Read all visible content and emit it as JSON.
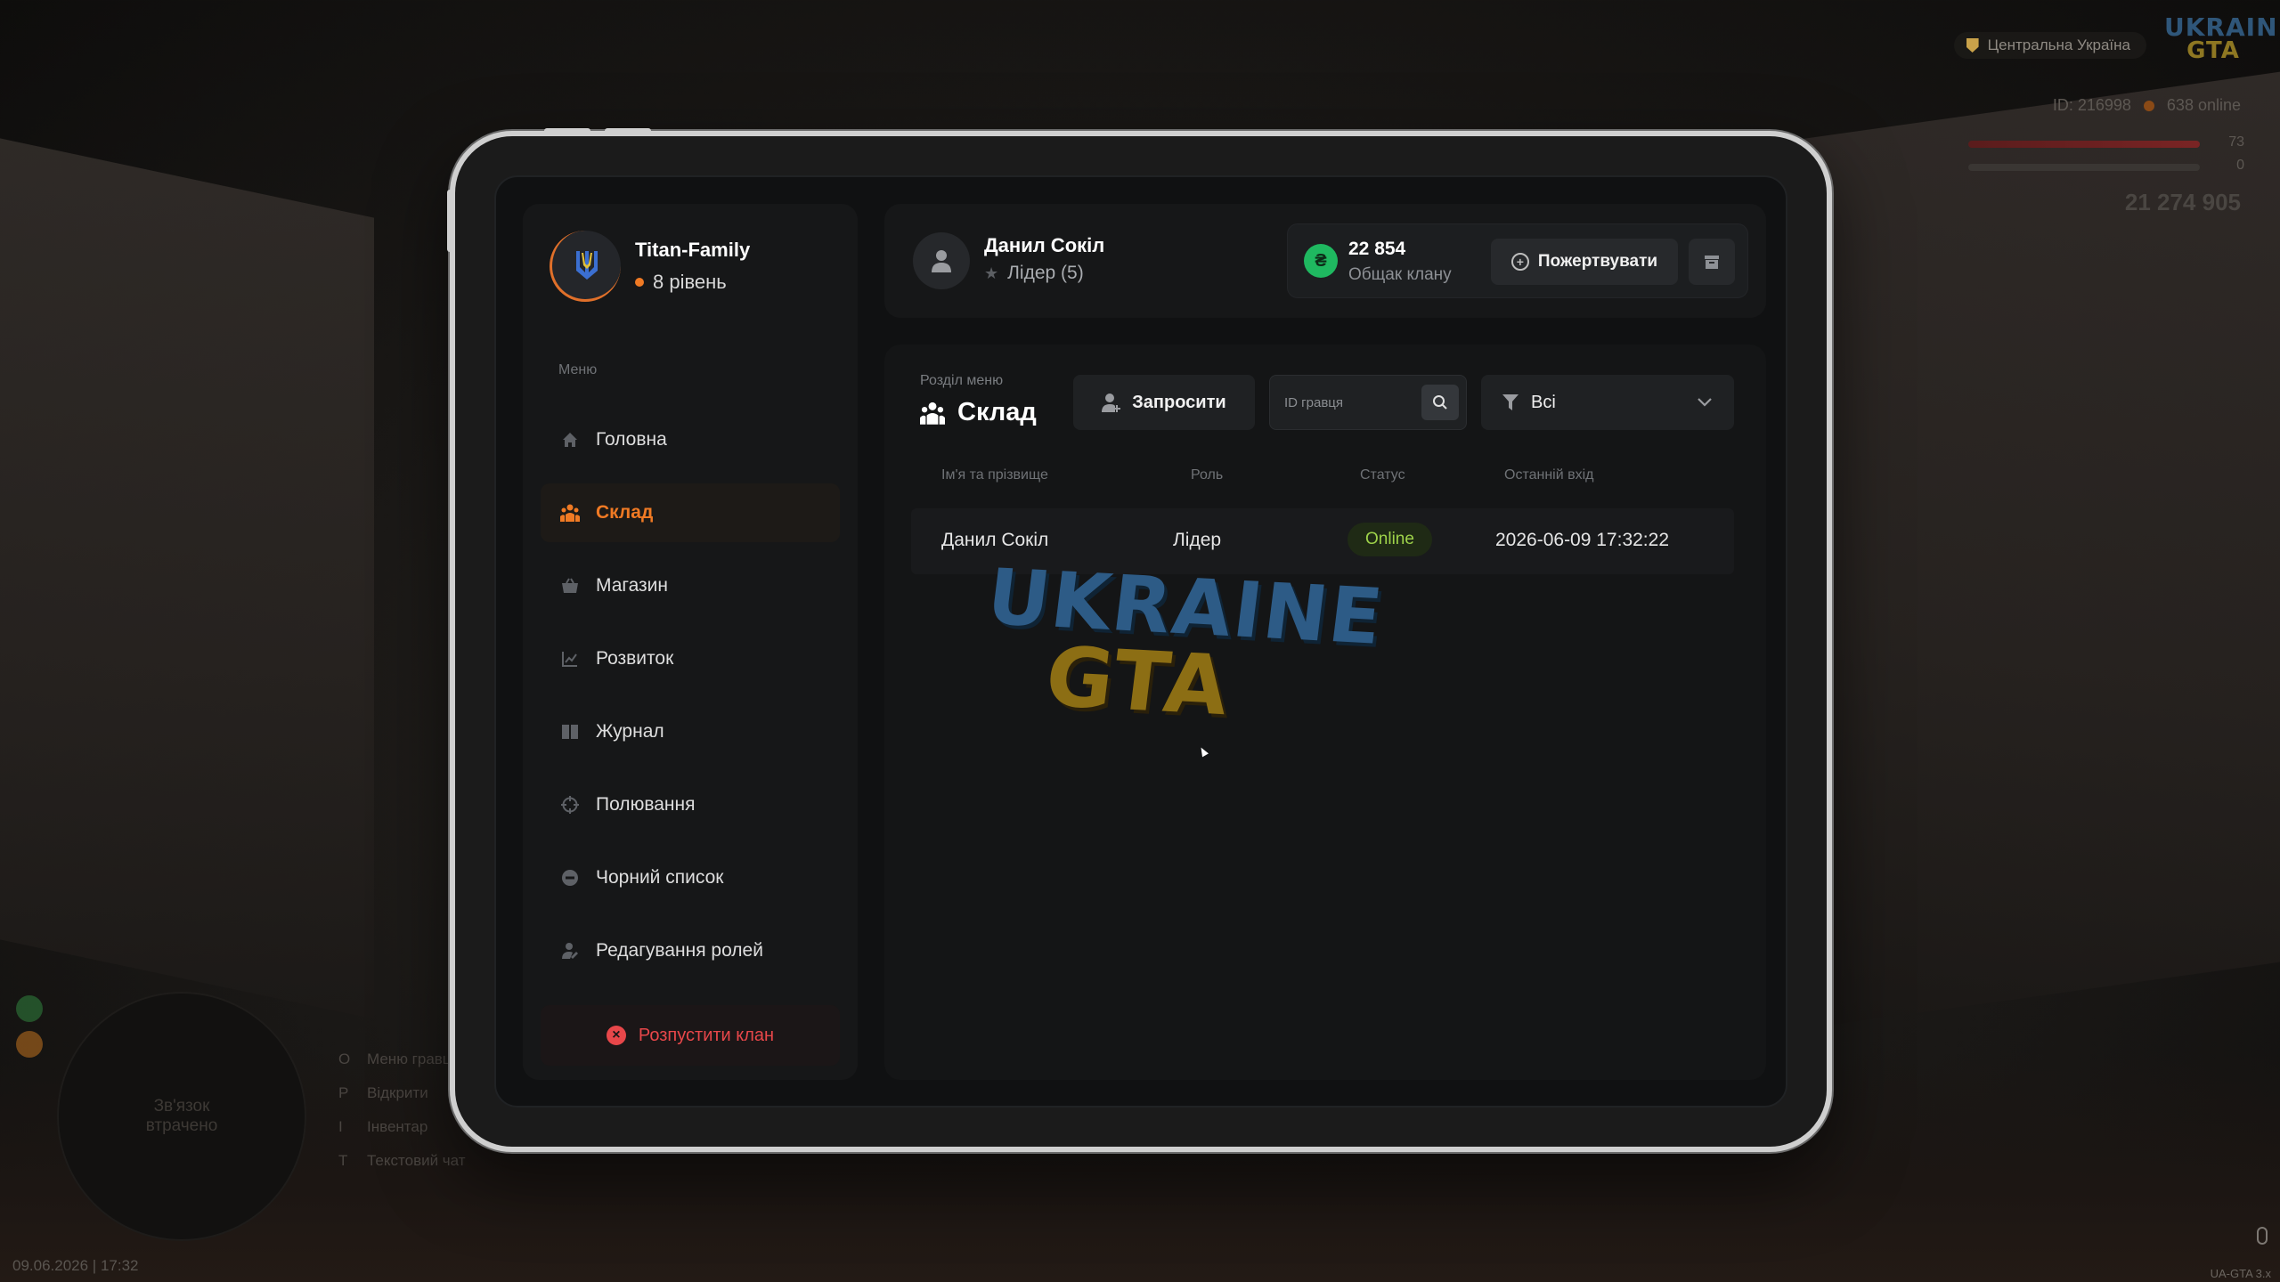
{
  "hud": {
    "region": "Центральна Україна",
    "logo_line1": "UKRAINE",
    "logo_line2": "GTA",
    "player_id": "ID: 216998",
    "online": "638 online",
    "health": "73",
    "armor": "0",
    "money": "21 274 905",
    "minimap_status": "Зв'язок втрачено",
    "keys": [
      {
        "key": "O",
        "label": "Меню гравця"
      },
      {
        "key": "P",
        "label": "Відкрити"
      },
      {
        "key": "I",
        "label": "Інвентар"
      },
      {
        "key": "T",
        "label": "Текстовий чат"
      }
    ],
    "datetime": "09.06.2026 | 17:32",
    "version": "UA-GTA 3.x"
  },
  "clan": {
    "name": "Titan-Family",
    "level": "8 рівень"
  },
  "menu": {
    "caption": "Меню",
    "items": [
      {
        "label": "Головна",
        "icon": "home-icon"
      },
      {
        "label": "Склад",
        "icon": "people-icon"
      },
      {
        "label": "Магазин",
        "icon": "basket-icon"
      },
      {
        "label": "Розвиток",
        "icon": "chart-icon"
      },
      {
        "label": "Журнал",
        "icon": "book-icon"
      },
      {
        "label": "Полювання",
        "icon": "crosshair-icon"
      },
      {
        "label": "Чорний список",
        "icon": "block-icon"
      },
      {
        "label": "Редагування ролей",
        "icon": "user-edit-icon"
      }
    ],
    "active": "Склад",
    "disband_label": "Розпустити клан"
  },
  "user": {
    "name": "Данил Сокіл",
    "role": "Лідер (5)"
  },
  "bank": {
    "value": "22 854",
    "label": "Общак клану",
    "donate_label": "Пожертвувати"
  },
  "section": {
    "caption": "Розділ меню",
    "title": "Склад",
    "invite_label": "Запросити",
    "search_placeholder": "ID гравця",
    "filter_value": "Всі"
  },
  "table": {
    "headers": [
      "Ім'я та прізвище",
      "Роль",
      "Статус",
      "Останній вхід"
    ],
    "rows": [
      {
        "name": "Данил Сокіл",
        "role": "Лідер",
        "status": "Online",
        "last_login": "2026-06-09 17:32:22"
      }
    ]
  },
  "watermark": {
    "line1": "UKRAINE",
    "line2": "GTA"
  },
  "colors": {
    "accent": "#f07a24",
    "danger": "#e8474a",
    "online": "#9ed24a",
    "coin": "#1fb860"
  }
}
